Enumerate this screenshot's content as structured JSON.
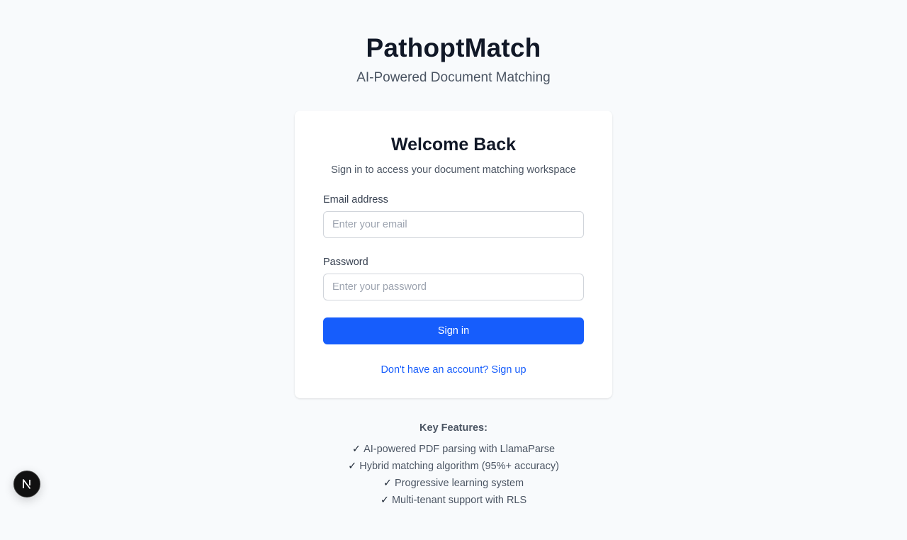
{
  "app": {
    "title": "PathoptMatch",
    "subtitle": "AI-Powered Document Matching"
  },
  "card": {
    "title": "Welcome Back",
    "subtitle": "Sign in to access your document matching workspace",
    "email": {
      "label": "Email address",
      "placeholder": "Enter your email",
      "value": ""
    },
    "password": {
      "label": "Password",
      "placeholder": "Enter your password",
      "value": ""
    },
    "signin_label": "Sign in",
    "signup_link": "Don't have an account? Sign up"
  },
  "features": {
    "title": "Key Features:",
    "check_glyph": "✓",
    "items": [
      "AI-powered PDF parsing with LlamaParse",
      "Hybrid matching algorithm (95%+ accuracy)",
      "Progressive learning system",
      "Multi-tenant support with RLS"
    ]
  },
  "dev_badge": {
    "icon": "nextjs-n-icon",
    "letter": "N"
  },
  "colors": {
    "primary": "#165dfc",
    "background": "#f8fafc",
    "card": "#ffffff",
    "text_dark": "#111827",
    "text_muted": "#4b5563"
  }
}
